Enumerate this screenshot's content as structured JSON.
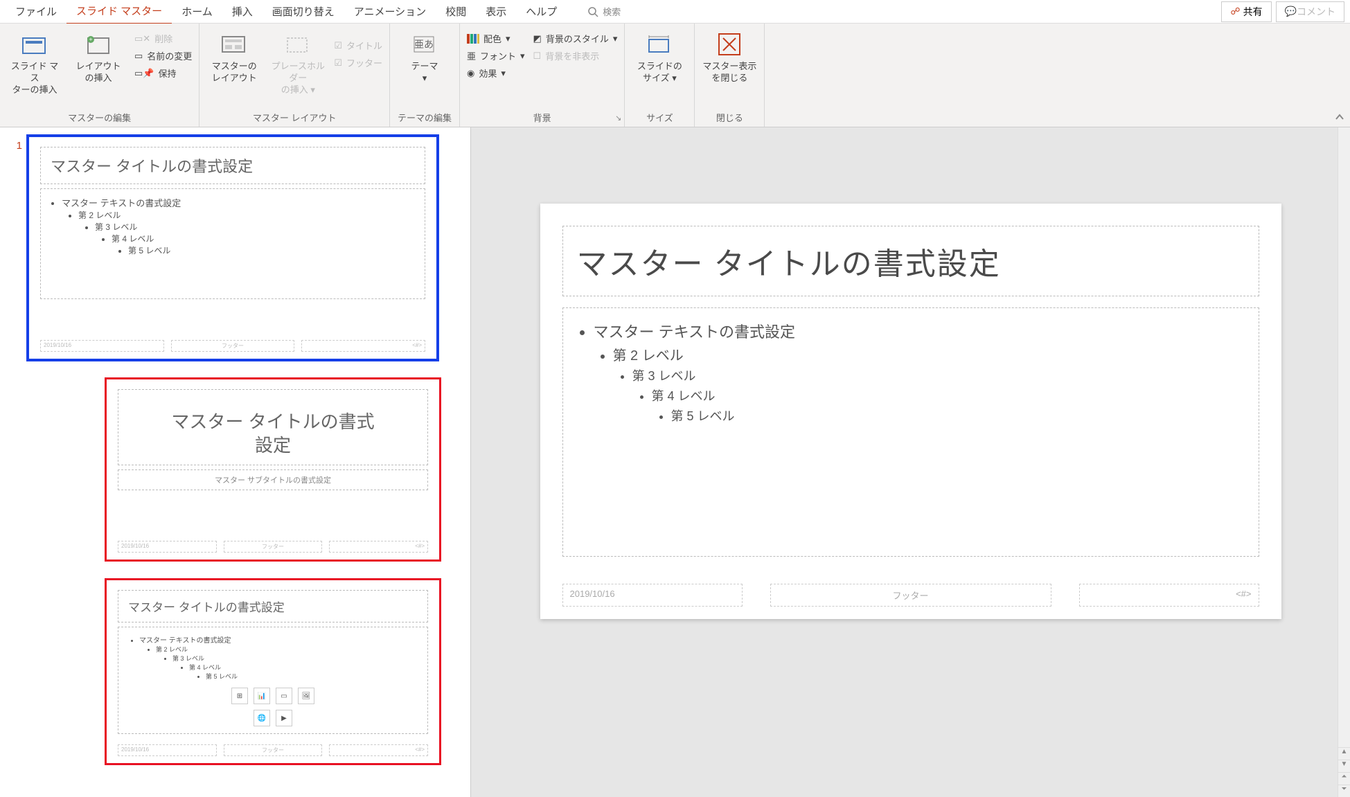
{
  "menubar": {
    "tabs": [
      "ファイル",
      "スライド マスター",
      "ホーム",
      "挿入",
      "画面切り替え",
      "アニメーション",
      "校閲",
      "表示",
      "ヘルプ"
    ],
    "active_index": 1,
    "search_label": "検索",
    "share_label": "共有",
    "comment_label": "コメント"
  },
  "ribbon": {
    "groups": {
      "master_edit": {
        "label": "マスターの編集",
        "insert_master": "スライド マス\nターの挿入",
        "insert_layout": "レイアウト\nの挿入",
        "delete": "削除",
        "rename": "名前の変更",
        "preserve": "保持"
      },
      "master_layout": {
        "label": "マスター レイアウト",
        "master_layout_btn": "マスターの\nレイアウト",
        "insert_placeholder": "プレースホルダー\nの挿入",
        "title_check": "タイトル",
        "footer_check": "フッター"
      },
      "theme_edit": {
        "label": "テーマの編集",
        "theme": "テーマ"
      },
      "background": {
        "label": "背景",
        "colors": "配色",
        "fonts": "フォント",
        "effects": "効果",
        "bg_styles": "背景のスタイル",
        "hide_bg": "背景を非表示"
      },
      "size": {
        "label": "サイズ",
        "slide_size": "スライドの\nサイズ"
      },
      "close": {
        "label": "閉じる",
        "close_master": "マスター表示\nを閉じる"
      }
    }
  },
  "thumbnails": {
    "master_number": "1",
    "master": {
      "title": "マスター タイトルの書式設定",
      "body_levels": [
        "マスター テキストの書式設定",
        "第 2 レベル",
        "第 3 レベル",
        "第 4 レベル",
        "第 5 レベル"
      ],
      "date": "2019/10/16",
      "footer": "フッター",
      "page": "<#>"
    },
    "layout1": {
      "title": "マスター タイトルの書式\n設定",
      "subtitle": "マスター サブタイトルの書式設定",
      "date": "2019/10/16",
      "footer": "フッター",
      "page": "<#>"
    },
    "layout2": {
      "title": "マスター タイトルの書式設定",
      "body_levels": [
        "マスター テキストの書式設定",
        "第 2 レベル",
        "第 3 レベル",
        "第 4 レベル",
        "第 5 レベル"
      ],
      "date": "2019/10/16",
      "footer": "フッター",
      "page": "<#>"
    }
  },
  "editor_slide": {
    "title": "マスター タイトルの書式設定",
    "body_levels": [
      "マスター テキストの書式設定",
      "第 2 レベル",
      "第 3 レベル",
      "第 4 レベル",
      "第 5 レベル"
    ],
    "date": "2019/10/16",
    "footer": "フッター",
    "page": "<#>"
  }
}
